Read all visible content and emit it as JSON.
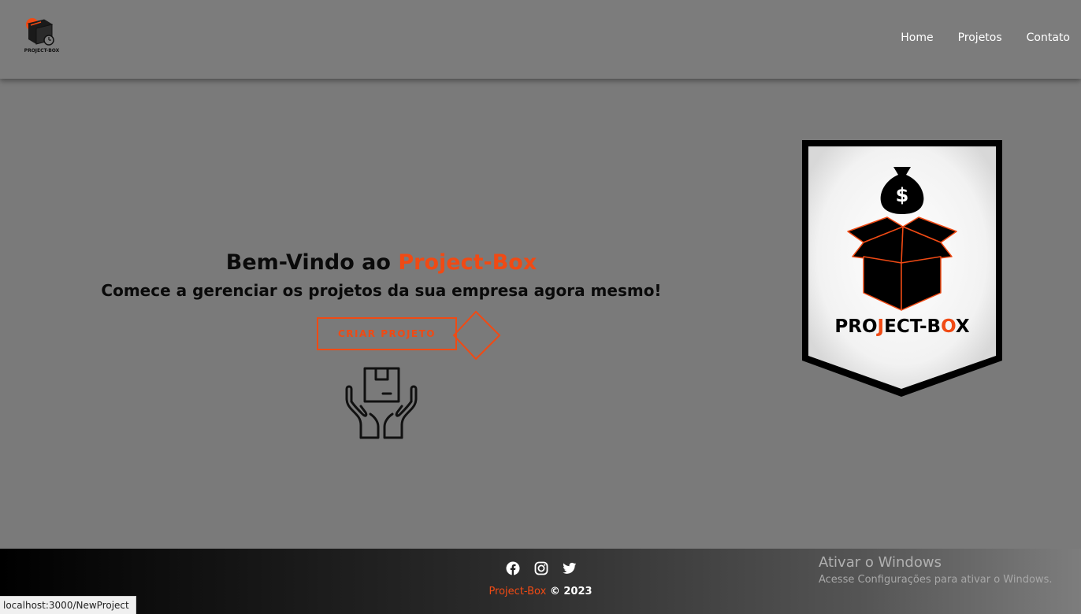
{
  "header": {
    "logo_text": "PROJECT-BOX",
    "nav": [
      {
        "label": "Home"
      },
      {
        "label": "Projetos"
      },
      {
        "label": "Contato"
      }
    ]
  },
  "hero": {
    "title_prefix": "Bem-Vindo ao ",
    "title_brand": "Project-Box",
    "subtitle": "Comece a gerenciar os projetos da sua empresa agora mesmo!",
    "cta_label": "CRIAR PROJETO",
    "icon": "hands-holding-box-icon"
  },
  "shield": {
    "text_part1": "PRO",
    "text_j": "J",
    "text_part2": "ECT-B",
    "text_o": "O",
    "text_part3": "X",
    "money_symbol": "$"
  },
  "footer": {
    "social_icons": [
      "facebook-icon",
      "instagram-icon",
      "twitter-icon"
    ],
    "brand": "Project-Box",
    "copyright": " © 2023"
  },
  "windows_watermark": {
    "title": "Ativar o Windows",
    "subtitle": "Acesse Configurações para ativar o Windows."
  },
  "status_bar": {
    "url": "localhost:3000/NewProject"
  },
  "colors": {
    "accent": "#f04a14",
    "background": "#7a7a7a",
    "header": "#7c7c7c"
  }
}
